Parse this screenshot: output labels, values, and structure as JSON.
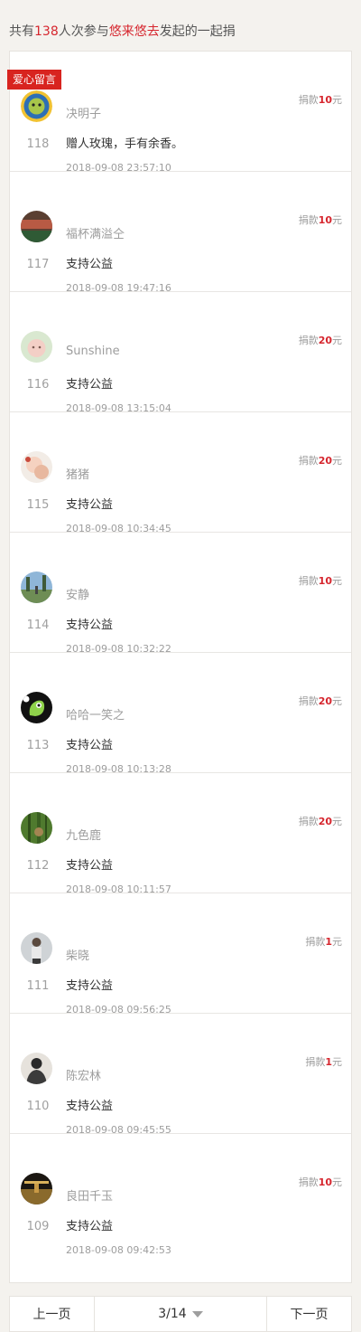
{
  "header": {
    "prefix": "共有",
    "count": "138",
    "middle": "人次参与",
    "initiator": "悠来悠去",
    "suffix": "发起的一起捐"
  },
  "tag_label": "爱心留言",
  "amount_prefix": "捐款",
  "amount_suffix": "元",
  "entries": [
    {
      "num": "118",
      "name": "决明子",
      "message": "赠人玫瑰，手有余香。",
      "time": "2018-09-08 23:57:10",
      "amount": "10"
    },
    {
      "num": "117",
      "name": "福杯满溢仝",
      "message": "支持公益",
      "time": "2018-09-08 19:47:16",
      "amount": "10"
    },
    {
      "num": "116",
      "name": "Sunshine",
      "message": "支持公益",
      "time": "2018-09-08 13:15:04",
      "amount": "20"
    },
    {
      "num": "115",
      "name": "猪猪",
      "message": "支持公益",
      "time": "2018-09-08 10:34:45",
      "amount": "20"
    },
    {
      "num": "114",
      "name": "安静",
      "message": "支持公益",
      "time": "2018-09-08 10:32:22",
      "amount": "10"
    },
    {
      "num": "113",
      "name": "哈哈一笑之",
      "message": "支持公益",
      "time": "2018-09-08 10:13:28",
      "amount": "20"
    },
    {
      "num": "112",
      "name": "九色鹿",
      "message": "支持公益",
      "time": "2018-09-08 10:11:57",
      "amount": "20"
    },
    {
      "num": "111",
      "name": "柴晓",
      "message": "支持公益",
      "time": "2018-09-08 09:56:25",
      "amount": "1"
    },
    {
      "num": "110",
      "name": "陈宏林",
      "message": "支持公益",
      "time": "2018-09-08 09:45:55",
      "amount": "1"
    },
    {
      "num": "109",
      "name": "良田千玉",
      "message": "支持公益",
      "time": "2018-09-08 09:42:53",
      "amount": "10"
    }
  ],
  "pager": {
    "prev": "上一页",
    "current": "3/14",
    "next": "下一页"
  },
  "colors": {
    "accent": "#d6262e",
    "tag_bg": "#d8241f",
    "page_bg": "#f4f2ee"
  }
}
